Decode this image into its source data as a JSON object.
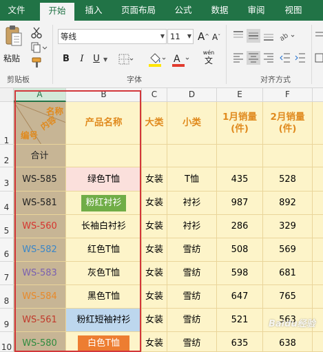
{
  "ribbon_tabs": [
    "文件",
    "开始",
    "插入",
    "页面布局",
    "公式",
    "数据",
    "审阅",
    "视图"
  ],
  "active_tab": "开始",
  "clipboard": {
    "paste_label": "粘贴",
    "group_label": "剪贴板"
  },
  "font": {
    "name": "等线",
    "size": "11",
    "group_label": "字体",
    "bold": "B",
    "italic": "I",
    "underline": "U",
    "grow": "A",
    "shrink": "A",
    "phonetic_top": "wén",
    "phonetic_bottom": "文"
  },
  "alignment": {
    "group_label": "对齐方式"
  },
  "column_headers": [
    "A",
    "B",
    "C",
    "D",
    "E",
    "F"
  ],
  "row_headers": [
    "1",
    "2",
    "3",
    "4",
    "5",
    "6",
    "7",
    "8",
    "9",
    "10"
  ],
  "header_row": {
    "diag_top": "名称",
    "diag_mid": "内容",
    "diag_bottom": "编号",
    "product": "产品名称",
    "category": "大类",
    "subcategory": "小类",
    "jan_sales": "1月销量(件)",
    "feb_sales": "2月销量(件)"
  },
  "total_row": {
    "label": "合计"
  },
  "rows": [
    {
      "id": "WS-585",
      "name": "绿色T恤",
      "cat": "女装",
      "sub": "T恤",
      "jan": "435",
      "feb": "528"
    },
    {
      "id": "WS-581",
      "name": "粉红衬衫",
      "cat": "女装",
      "sub": "衬衫",
      "jan": "987",
      "feb": "892"
    },
    {
      "id": "WS-560",
      "name": "长袖白衬衫",
      "cat": "女装",
      "sub": "衬衫",
      "jan": "286",
      "feb": "329"
    },
    {
      "id": "WS-582",
      "name": "红色T恤",
      "cat": "女装",
      "sub": "雪纺",
      "jan": "508",
      "feb": "569"
    },
    {
      "id": "WS-583",
      "name": "灰色T恤",
      "cat": "女装",
      "sub": "雪纺",
      "jan": "598",
      "feb": "681"
    },
    {
      "id": "WS-584",
      "name": "黑色T恤",
      "cat": "女装",
      "sub": "雪纺",
      "jan": "647",
      "feb": "765"
    },
    {
      "id": "WS-561",
      "name": "粉红短袖衬衫",
      "cat": "女装",
      "sub": "雪纺",
      "jan": "521",
      "feb": "563"
    },
    {
      "id": "WS-580",
      "name": "白色T恤",
      "cat": "女装",
      "sub": "雪纺",
      "jan": "635",
      "feb": "638"
    }
  ],
  "colors": {
    "excel_green": "#217346",
    "cell_fill": "#fdf4c9",
    "id_fill": "#c7b595",
    "header_text": "#e08a1e",
    "selection_box": "#d2363b",
    "name_pink": "#fbe0dc",
    "name_green": "#70ad47",
    "name_blue": "#bdd7ee",
    "name_orange": "#ed7d31"
  },
  "watermark": "Baidu经验"
}
